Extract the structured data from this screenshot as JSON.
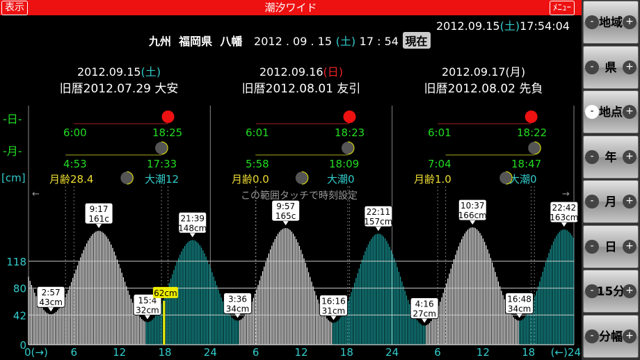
{
  "topbar": {
    "display_button": "表示",
    "title": "潮汐ワイド",
    "menu_button": "ﾒﾆｭｰ"
  },
  "clock": {
    "date": "2012.09.15",
    "weekday": "土",
    "time": "17:54:04"
  },
  "location": {
    "region": "九州",
    "prefecture": "福岡県",
    "place": "八幡",
    "date": "2012 . 09 . 15",
    "weekday": "土",
    "time": "17 : 54",
    "now_button": "現在"
  },
  "row_labels": {
    "sun": "-日-",
    "moon": "-月-",
    "unit": "[cm]"
  },
  "touch_hint": "この範囲タッチで時刻設定",
  "arrow_left": "←",
  "arrow_right": "→",
  "days": [
    {
      "date": "2012.09.15",
      "weekday": "土",
      "weekday_color": "#33cccc",
      "lunar": "旧暦2012.07.29 大安",
      "sunrise": "6:00",
      "sunset": "18:25",
      "moonrise": "4:53",
      "moonset": "17:33",
      "moon_age": "月齢28.4",
      "tide_type": "大潮12"
    },
    {
      "date": "2012.09.16",
      "weekday": "日",
      "weekday_color": "#ee2222",
      "lunar": "旧暦2012.08.01 友引",
      "sunrise": "6:01",
      "sunset": "18:23",
      "moonrise": "5:58",
      "moonset": "18:09",
      "moon_age": "月齢0.0",
      "tide_type": "大潮0"
    },
    {
      "date": "2012.09.17",
      "weekday": "月",
      "weekday_color": "#ffffff",
      "lunar": "旧暦2012.08.02 先負",
      "sunrise": "6:01",
      "sunset": "18:22",
      "moonrise": "7:04",
      "moonset": "18:47",
      "moon_age": "月齢1.0",
      "tide_type": "大潮0"
    }
  ],
  "side_buttons": [
    {
      "label": "地域",
      "active": false
    },
    {
      "label": "県",
      "active": false
    },
    {
      "label": "地点",
      "active": true
    },
    {
      "label": "年",
      "active": false
    },
    {
      "label": "月",
      "active": false
    },
    {
      "label": "日",
      "active": false
    },
    {
      "label": "15分",
      "active": false
    },
    {
      "label": "分幅",
      "active": false
    }
  ],
  "side_minus": "-",
  "side_plus": "+",
  "colors": {
    "high_fill": "#ffffff",
    "low_fill": "#1aa5a5",
    "sun": "#ee1111",
    "moon": "#555555",
    "current": "#eeee00"
  },
  "chart_data": {
    "type": "area",
    "title": "",
    "xlabel": "",
    "ylabel": "[cm]",
    "y_ticks": [
      0,
      42,
      80,
      118
    ],
    "ylim": [
      0,
      170
    ],
    "x_ticks": [
      "0(→)",
      "6",
      "12",
      "18",
      "24",
      "6",
      "12",
      "18",
      "24",
      "6",
      "12",
      "18",
      "(←)24"
    ],
    "xlim_hours": [
      0,
      72
    ],
    "extrema": [
      {
        "time": "2:57",
        "value_label": "43cm",
        "value": 43,
        "type": "low"
      },
      {
        "time": "9:17",
        "value_label": "161c",
        "value": 161,
        "type": "high"
      },
      {
        "time": "15:4",
        "value_label": "32cm",
        "value": 32,
        "type": "low"
      },
      {
        "time": "21:39",
        "value_label": "148cm",
        "value": 148,
        "type": "high"
      },
      {
        "time": "3:36",
        "value_label": "34cm",
        "value": 34,
        "type": "low"
      },
      {
        "time": "9:57",
        "value_label": "165c",
        "value": 165,
        "type": "high"
      },
      {
        "time": "16:16",
        "value_label": "31cm",
        "value": 31,
        "type": "low"
      },
      {
        "time": "22:11",
        "value_label": "157cm",
        "value": 157,
        "type": "high"
      },
      {
        "time": "4:16",
        "value_label": "27cm",
        "value": 27,
        "type": "low"
      },
      {
        "time": "10:37",
        "value_label": "166cm",
        "value": 166,
        "type": "high"
      },
      {
        "time": "16:48",
        "value_label": "34cm",
        "value": 34,
        "type": "low"
      },
      {
        "time": "22:42",
        "value_label": "163cm",
        "value": 163,
        "type": "high"
      }
    ],
    "extrema_hours": [
      2.95,
      9.283,
      15.7,
      21.65,
      27.6,
      33.95,
      40.267,
      46.183,
      52.267,
      58.617,
      64.8,
      70.7
    ],
    "current": {
      "label": "62cm",
      "value": 62,
      "hour": 17.9
    }
  }
}
